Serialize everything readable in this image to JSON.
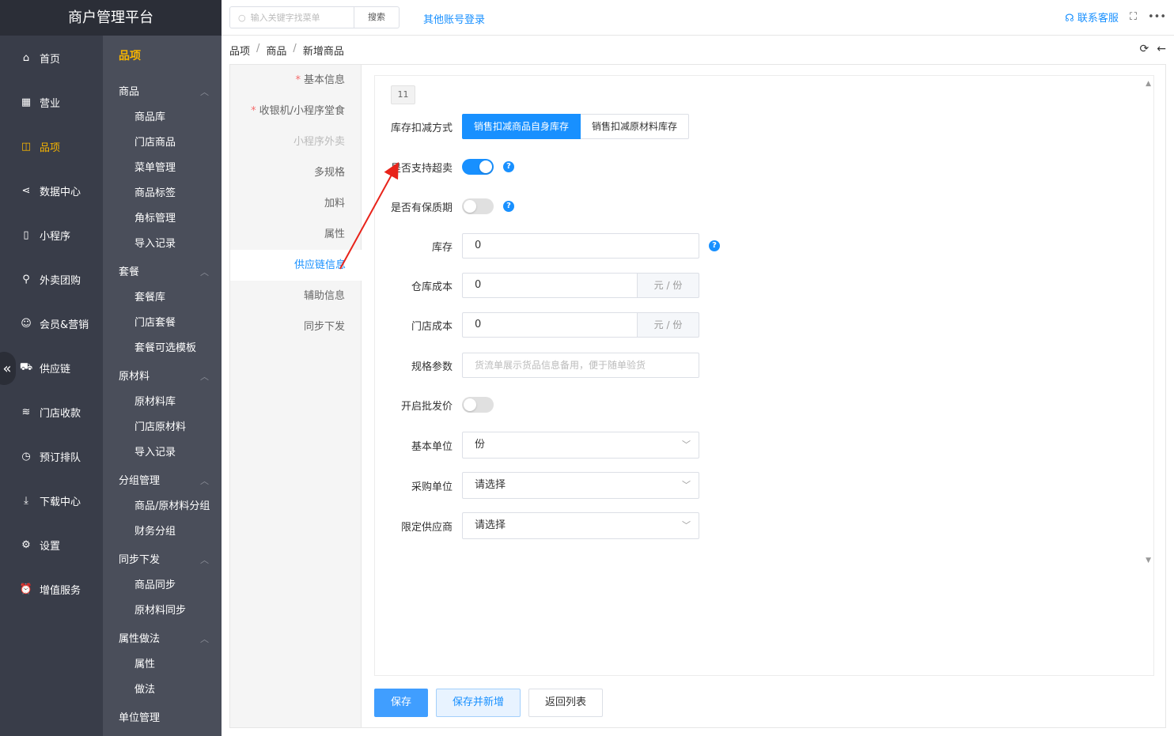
{
  "brand": "商户管理平台",
  "nav": [
    {
      "label": "首页",
      "icon": "home-icon",
      "glyph": "⌂"
    },
    {
      "label": "营业",
      "icon": "calendar-icon",
      "glyph": "▦"
    },
    {
      "label": "品项",
      "icon": "bag-icon",
      "glyph": "◫"
    },
    {
      "label": "数据中心",
      "icon": "share-icon",
      "glyph": "⋖"
    },
    {
      "label": "小程序",
      "icon": "mobile-icon",
      "glyph": "▯"
    },
    {
      "label": "外卖团购",
      "icon": "bike-icon",
      "glyph": "⚲"
    },
    {
      "label": "会员&营销",
      "icon": "user-icon",
      "glyph": "☺"
    },
    {
      "label": "供应链",
      "icon": "truck-icon",
      "glyph": "⛟"
    },
    {
      "label": "门店收款",
      "icon": "database-icon",
      "glyph": "≋"
    },
    {
      "label": "预订排队",
      "icon": "clock-icon",
      "glyph": "◷"
    },
    {
      "label": "下载中心",
      "icon": "download-icon",
      "glyph": "⤓"
    },
    {
      "label": "设置",
      "icon": "gear-icon",
      "glyph": "⚙"
    },
    {
      "label": "增值服务",
      "icon": "alarm-icon",
      "glyph": "⏰"
    }
  ],
  "nav_active": 2,
  "submenu": {
    "title": "品项",
    "groups": [
      {
        "label": "商品",
        "items": [
          "商品库",
          "门店商品",
          "菜单管理",
          "商品标签",
          "角标管理",
          "导入记录"
        ]
      },
      {
        "label": "套餐",
        "items": [
          "套餐库",
          "门店套餐",
          "套餐可选模板"
        ]
      },
      {
        "label": "原材料",
        "items": [
          "原材料库",
          "门店原材料",
          "导入记录"
        ]
      },
      {
        "label": "分组管理",
        "items": [
          "商品/原材料分组",
          "财务分组"
        ]
      },
      {
        "label": "同步下发",
        "items": [
          "商品同步",
          "原材料同步"
        ]
      },
      {
        "label": "属性做法",
        "items": [
          "属性",
          "做法"
        ]
      },
      {
        "label": "单位管理",
        "items": []
      }
    ]
  },
  "topbar": {
    "search_placeholder": "输入关键字找菜单",
    "search_button": "搜索",
    "other_login": "其他账号登录",
    "contact": "联系客服"
  },
  "breadcrumb": [
    "品项",
    "商品",
    "新增商品"
  ],
  "tabs": [
    {
      "label": "基本信息",
      "required": true,
      "state": "normal"
    },
    {
      "label": "收银机/小程序堂食",
      "required": true,
      "state": "normal"
    },
    {
      "label": "小程序外卖",
      "required": false,
      "state": "disabled"
    },
    {
      "label": "多规格",
      "required": false,
      "state": "normal"
    },
    {
      "label": "加料",
      "required": false,
      "state": "normal"
    },
    {
      "label": "属性",
      "required": false,
      "state": "normal"
    },
    {
      "label": "供应链信息",
      "required": false,
      "state": "active"
    },
    {
      "label": "辅助信息",
      "required": false,
      "state": "normal"
    },
    {
      "label": "同步下发",
      "required": false,
      "state": "normal"
    }
  ],
  "form": {
    "badge": "11",
    "stock_method_label": "库存扣减方式",
    "stock_method_options": [
      "销售扣减商品自身库存",
      "销售扣减原材料库存"
    ],
    "oversell_label": "是否支持超卖",
    "oversell_on": true,
    "shelf_life_label": "是否有保质期",
    "shelf_life_on": false,
    "stock_label": "库存",
    "stock_value": "0",
    "warehouse_cost_label": "仓库成本",
    "warehouse_cost_value": "0",
    "store_cost_label": "门店成本",
    "store_cost_value": "0",
    "cost_unit": "元 / 份",
    "spec_label": "规格参数",
    "spec_placeholder": "货流单展示货品信息备用，便于随单验货",
    "wholesale_label": "开启批发价",
    "wholesale_on": false,
    "base_unit_label": "基本单位",
    "base_unit_value": "份",
    "purchase_unit_label": "采购单位",
    "purchase_unit_value": "请选择",
    "supplier_label": "限定供应商",
    "supplier_value": "请选择"
  },
  "actions": {
    "save": "保存",
    "save_new": "保存并新增",
    "back": "返回列表"
  },
  "colors": {
    "accent": "#1890ff",
    "nav_bg": "#393d49",
    "submenu_bg": "#4a4e5a",
    "active_yellow": "#f7b500",
    "annotation_red": "#e8231a"
  }
}
